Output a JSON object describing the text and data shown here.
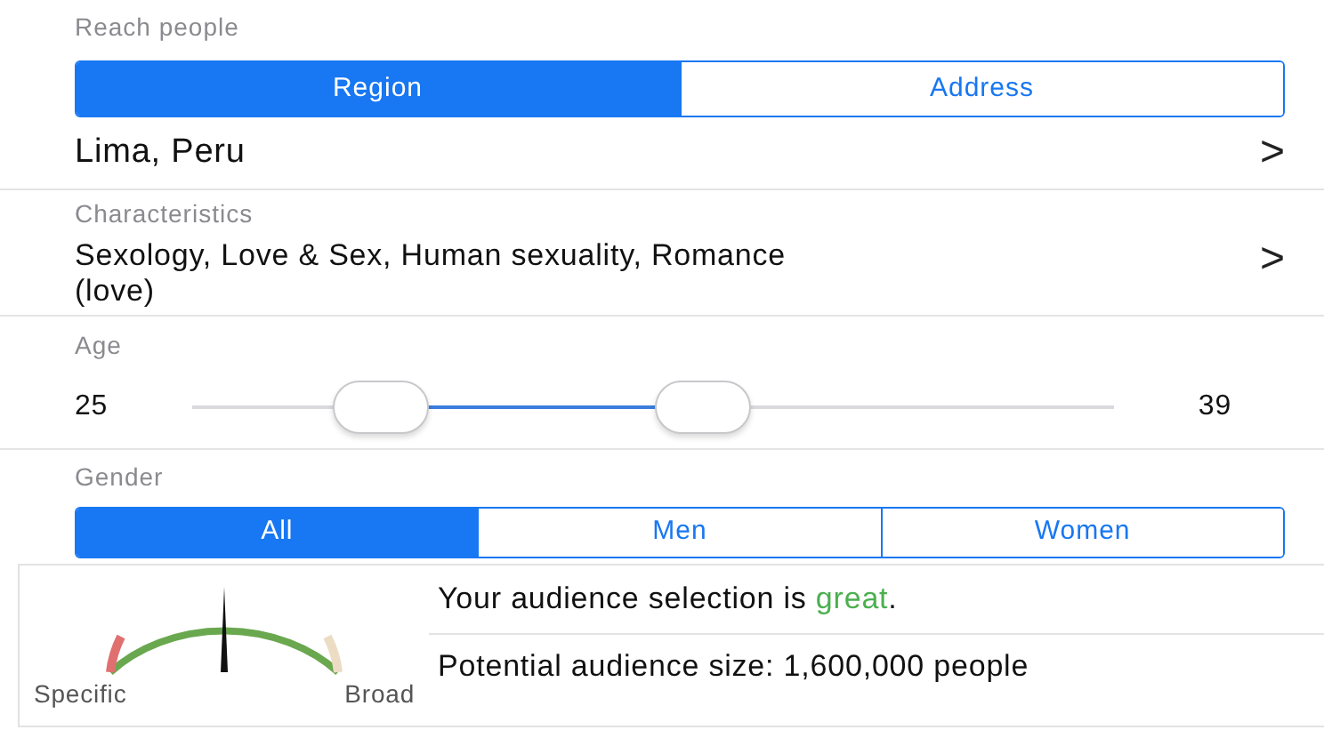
{
  "reach": {
    "label": "Reach people",
    "options": [
      {
        "label": "Region",
        "selected": true
      },
      {
        "label": "Address",
        "selected": false
      }
    ]
  },
  "location": {
    "value": "Lima, Peru",
    "chevron": ">"
  },
  "characteristics": {
    "label": "Characteristics",
    "value": "Sexology, Love & Sex, Human sexuality, Romance (love)",
    "chevron": ">"
  },
  "age": {
    "label": "Age",
    "min": "25",
    "max": "39",
    "thumbs": [
      {
        "level": 0.205
      },
      {
        "level": 0.555
      }
    ]
  },
  "gender": {
    "label": "Gender",
    "options": [
      {
        "label": "All",
        "selected": true
      },
      {
        "label": "Men",
        "selected": false
      },
      {
        "label": "Women",
        "selected": false
      }
    ]
  },
  "audience": {
    "gauge_left": "Specific",
    "gauge_right": "Broad",
    "selection_before": "Your audience selection is ",
    "selection_rating": "great",
    "selection_after": ".",
    "size": "Potential audience size: 1,600,000 people"
  }
}
